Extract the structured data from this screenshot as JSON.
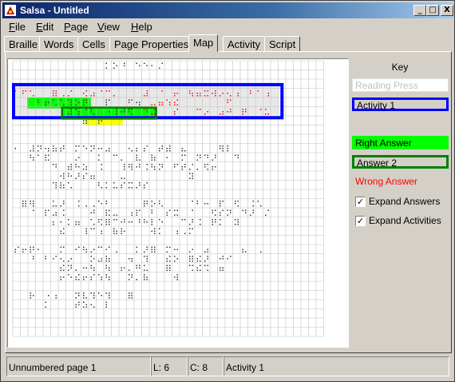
{
  "window": {
    "title": "Salsa - Untitled",
    "controls": [
      "_",
      "□",
      "X"
    ]
  },
  "menu": [
    {
      "label": "File",
      "mnemonic": "F",
      "rest": "ile"
    },
    {
      "label": "Edit",
      "mnemonic": "E",
      "rest": "dit"
    },
    {
      "label": "Page",
      "mnemonic": "P",
      "rest": "age"
    },
    {
      "label": "View",
      "mnemonic": "V",
      "rest": "iew"
    },
    {
      "label": "Help",
      "mnemonic": "H",
      "rest": "elp"
    }
  ],
  "tabs": [
    "Braille",
    "Words",
    "Cells",
    "Page Properties",
    "Map",
    "Activity",
    "Script"
  ],
  "active_tab": "Map",
  "key": {
    "title": "Key",
    "items": [
      {
        "label": "Reading Press",
        "color": "#c0c0c0",
        "fill": "#ffffff",
        "border": "#e0e0e0"
      },
      {
        "label": "Activity 1",
        "color": "#000000",
        "fill": "#d4d0c8",
        "border": "#0000ff"
      },
      {
        "label": "Right Answer",
        "color": "#000000",
        "fill": "#00ff00",
        "border": "#00ff00"
      },
      {
        "label": "Answer 2",
        "color": "#000000",
        "fill": "#d4d0c8",
        "border": "#008000"
      },
      {
        "label": "Wrong Answer",
        "color": "#ff0000",
        "fill": "#d4d0c8",
        "border": "#d4d0c8"
      }
    ],
    "checkboxes": [
      {
        "label": "Expand Answers",
        "checked": true
      },
      {
        "label": "Expand Activities",
        "checked": true
      }
    ]
  },
  "status": {
    "page": "Unnumbered page 1",
    "line": "L: 6",
    "column": "C: 8",
    "activity": "Activity 1"
  },
  "colors": {
    "activity_border": "#0000ff",
    "right_answer": "#00ff00",
    "answer_border": "#008000",
    "wrong_answer": "#ff0000",
    "highlight": "#ffff00",
    "grid_line": "#c0c0c0",
    "braille_dot": "#000000"
  }
}
